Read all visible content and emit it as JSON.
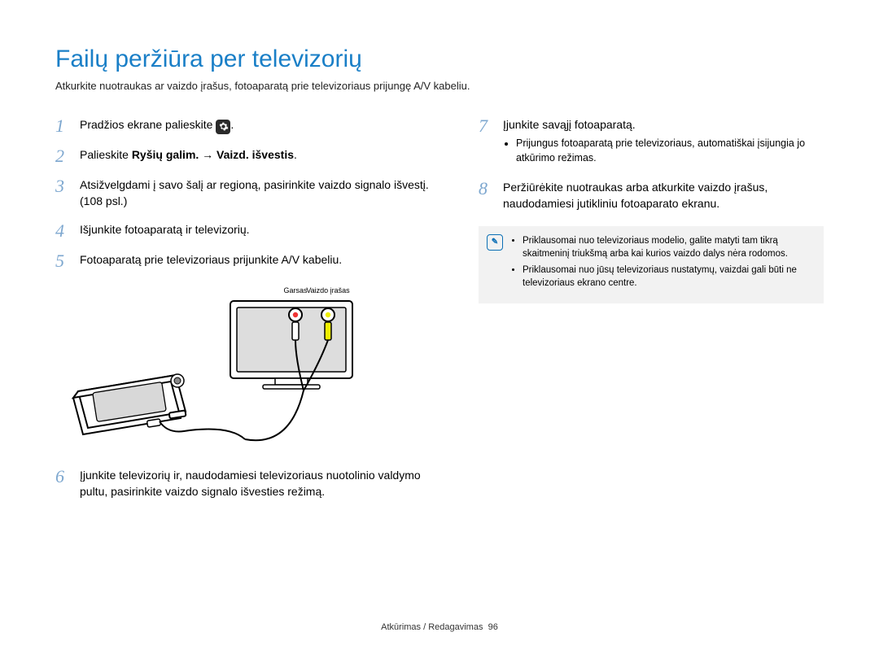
{
  "title": "Failų peržiūra per televizorių",
  "subtitle": "Atkurkite nuotraukas ar vaizdo įrašus, fotoaparatą prie televizoriaus prijungę A/V kabeliu.",
  "steps": {
    "s1": {
      "num": "1",
      "pre": "Pradžios ekrane palieskite ",
      "post": "."
    },
    "s2": {
      "num": "2",
      "pre": "Palieskite ",
      "bold": "Ryšių galim. → Vaizd. išvestis",
      "post": "."
    },
    "s3": {
      "num": "3",
      "text": "Atsižvelgdami į savo šalį ar regioną, pasirinkite vaizdo signalo išvestį. (108 psl.)"
    },
    "s4": {
      "num": "4",
      "text": "Išjunkite fotoaparatą ir televizorių."
    },
    "s5": {
      "num": "5",
      "text": "Fotoaparatą prie televizoriaus prijunkite A/V kabeliu."
    },
    "s6": {
      "num": "6",
      "text": "Įjunkite televizorių ir, naudodamiesi televizoriaus nuotolinio valdymo pultu, pasirinkite vaizdo signalo išvesties režimą."
    },
    "s7": {
      "num": "7",
      "text": "Įjunkite savąjį fotoaparatą.",
      "bullets": [
        "Prijungus fotoaparatą prie televizoriaus, automatiškai įsijungia jo atkūrimo režimas."
      ]
    },
    "s8": {
      "num": "8",
      "text": "Peržiūrėkite nuotraukas arba atkurkite vaizdo įrašus, naudodamiesi jutikliniu fotoaparato ekranu."
    }
  },
  "diagram": {
    "label_audio": "Garsas",
    "label_video": "Vaizdo įrašas"
  },
  "note": {
    "items": [
      "Priklausomai nuo televizoriaus modelio, galite matyti tam tikrą skaitmeninį triukšmą arba kai kurios vaizdo dalys nėra rodomos.",
      "Priklausomai nuo jūsų televizoriaus nustatymų, vaizdai gali būti ne televizoriaus ekrano centre."
    ]
  },
  "footer": {
    "section": "Atkūrimas / Redagavimas",
    "page": "96"
  }
}
